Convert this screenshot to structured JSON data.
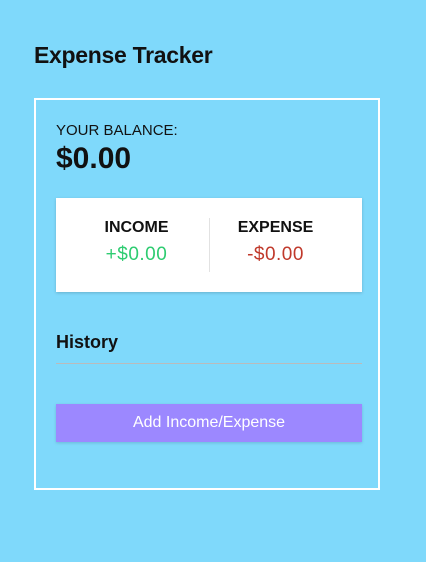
{
  "app": {
    "title": "Expense Tracker"
  },
  "balance": {
    "label": "YOUR BALANCE:",
    "amount": "$0.00"
  },
  "summary": {
    "income_label": "INCOME",
    "income_value": "+$0.00",
    "expense_label": "EXPENSE",
    "expense_value": "-$0.00"
  },
  "history": {
    "title": "History"
  },
  "actions": {
    "add_label": "Add Income/Expense"
  },
  "colors": {
    "background": "#7fd9fb",
    "income": "#2ecc71",
    "expense": "#c0392b",
    "button": "#9c88ff"
  }
}
